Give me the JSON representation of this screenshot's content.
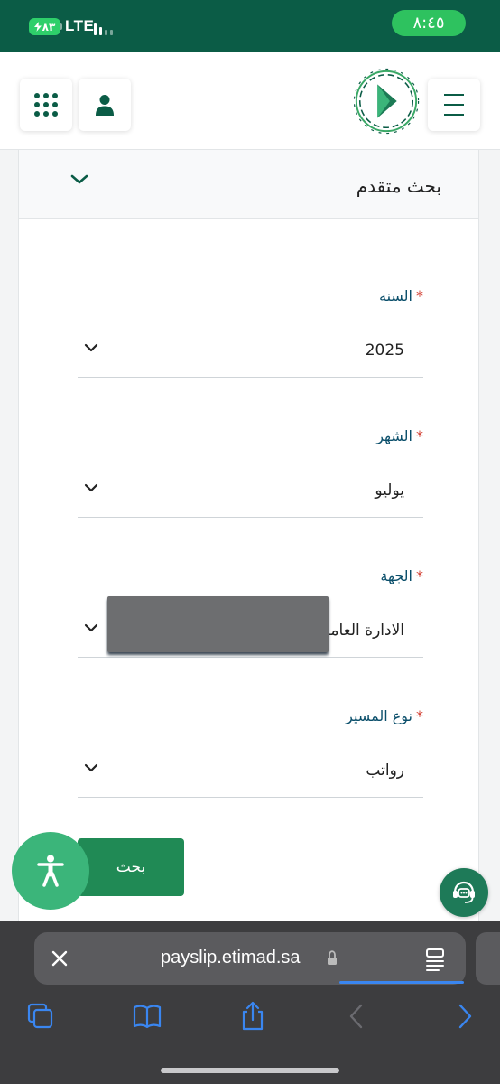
{
  "status_bar": {
    "battery": "٨٣",
    "carrier": "LTE",
    "time": "٨:٤٥"
  },
  "header": {
    "apps_icon": "apps-grid-icon",
    "profile_icon": "user-icon",
    "logo": "etimad-logo",
    "menu_icon": "hamburger-menu-icon"
  },
  "advanced_search": {
    "title": "بحث متقدم",
    "toggle_icon": "chevron-down-icon"
  },
  "form": {
    "required_mark": "*",
    "year": {
      "label": "السنه",
      "value": "2025"
    },
    "month": {
      "label": "الشهر",
      "value": "يوليو"
    },
    "entity": {
      "label": "الجهة",
      "value": "الادارة العامة"
    },
    "payroll_type": {
      "label": "نوع المسير",
      "value": "رواتب"
    },
    "search_button": "بحث"
  },
  "floating": {
    "accessibility_icon": "accessibility-icon",
    "support_icon": "headset-support-icon"
  },
  "browser": {
    "url": "payslip.etimad.sa",
    "close_icon": "close-icon",
    "lock_icon": "lock-icon",
    "reader_icon": "reader-mode-icon",
    "toolbar_icons": [
      "tabs-icon",
      "bookmarks-icon",
      "share-icon",
      "back-icon",
      "forward-icon"
    ]
  },
  "colors": {
    "brand_dark": "#0b5c46",
    "brand_green": "#208a55",
    "status_pill": "#2ec25f",
    "label_blue": "#0b4f6b",
    "required_red": "#d23b2e",
    "link_blue": "#3a86f0"
  }
}
